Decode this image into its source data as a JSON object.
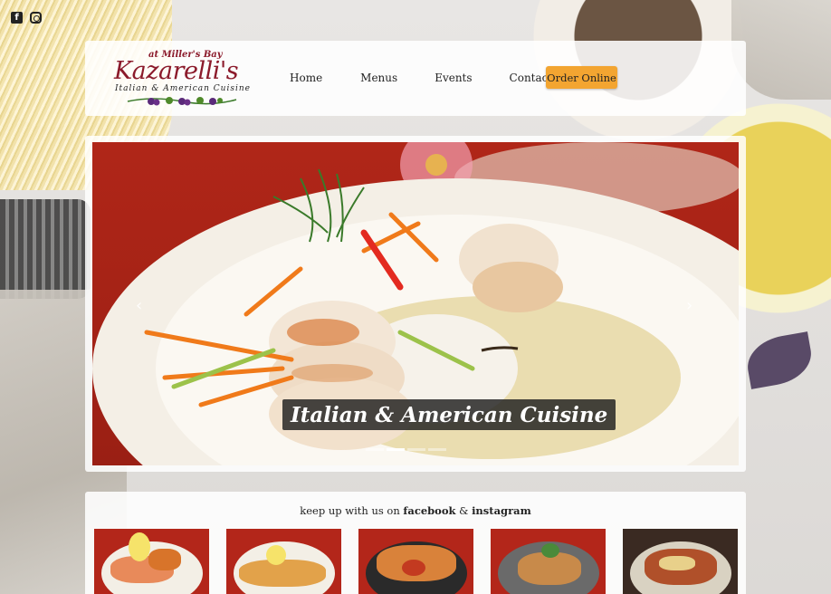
{
  "social": {
    "facebook_icon": "facebook-icon",
    "instagram_icon": "instagram-icon"
  },
  "logo": {
    "top": "at Miller's Bay",
    "name": "Kazarelli's",
    "tagline": "Italian & American Cuisine"
  },
  "nav": {
    "items": [
      "Home",
      "Menus",
      "Events",
      "Contact"
    ],
    "order_button": "Order Online"
  },
  "slider": {
    "caption": "Italian & American Cuisine",
    "prev_icon": "chevron-left-icon",
    "next_icon": "chevron-right-icon",
    "slide_count": 4,
    "active_slide": 2
  },
  "feed": {
    "prefix": "keep up with us on ",
    "facebook": "facebook",
    "amp": " & ",
    "instagram": "instagram"
  },
  "colors": {
    "brand": "#8b1a2b",
    "order_button": "#f3a531",
    "slide_background": "#b02618"
  }
}
